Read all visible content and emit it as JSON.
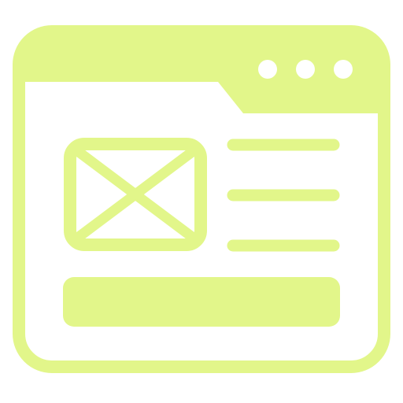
{
  "icon": {
    "name": "browser-window-email-template-icon",
    "color": "#E2F68A",
    "background": "#FFFFFF"
  },
  "window": {
    "controls": [
      "window-dot-1",
      "window-dot-2",
      "window-dot-3"
    ]
  },
  "content": {
    "image_placeholder_icon": "image-placeholder-icon",
    "text_lines": 3,
    "action_bar": "action-bar"
  }
}
